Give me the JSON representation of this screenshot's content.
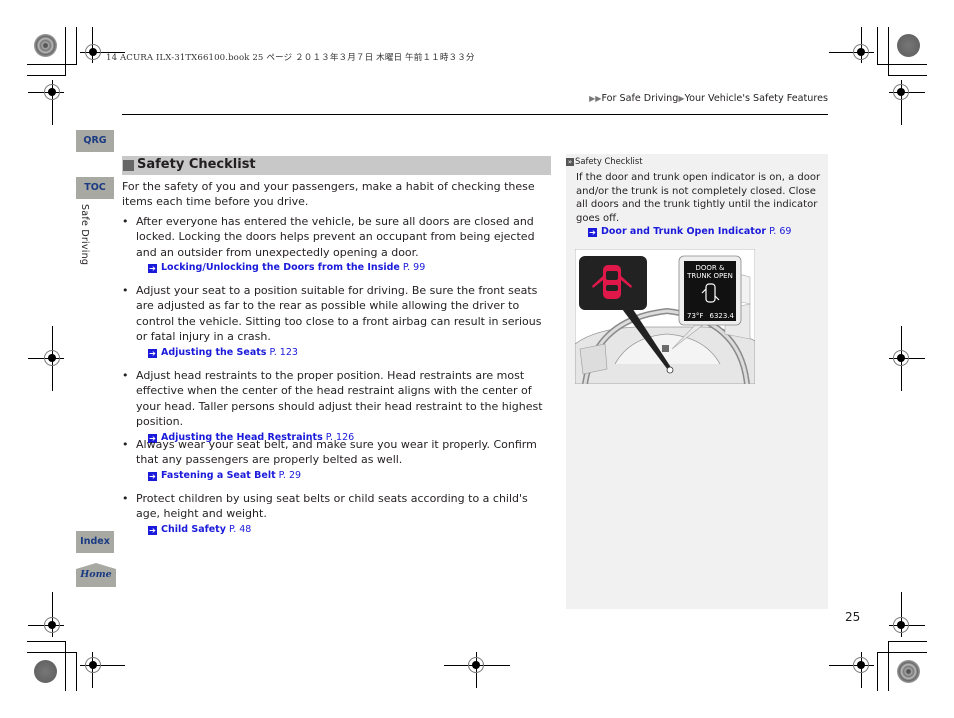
{
  "print_header": "14 ACURA ILX-31TX66100.book  25 ページ  ２０１３年３月７日  木曜日  午前１１時３３分",
  "breadcrumb": {
    "items": [
      "For Safe Driving",
      "Your Vehicle's Safety Features"
    ]
  },
  "side_nav": {
    "qrg_label": "QRG",
    "toc_label": "TOC",
    "chapter_label": "Safe Driving",
    "index_label": "Index",
    "home_label": "Home"
  },
  "section": {
    "title": "Safety Checklist",
    "intro": "For the safety of you and your passengers, make a habit of checking these items each time before you drive.",
    "bullets": [
      {
        "text": "After everyone has entered the vehicle, be sure all doors are closed and locked. Locking the doors helps prevent an occupant from being ejected and an outsider from unexpectedly opening a door.",
        "xref_title": "Locking/Unlocking the Doors from the Inside",
        "xref_page": "P. 99"
      },
      {
        "text": "Adjust your seat to a position suitable for driving. Be sure the front seats are adjusted as far to the rear as possible while allowing the driver to control the vehicle. Sitting too close to a front airbag can result in serious or fatal injury in a crash.",
        "xref_title": "Adjusting the Seats",
        "xref_page": "P. 123"
      },
      {
        "text": "Adjust head restraints to the proper position. Head restraints are most effective when the center of the head restraint aligns with the center of your head. Taller persons should adjust their head restraint to the highest position.",
        "xref_title": "Adjusting the Head Restraints",
        "xref_page": "P. 126"
      },
      {
        "text": "Always wear your seat belt, and make sure you wear it properly. Confirm that any passengers are properly belted as well.",
        "xref_title": "Fastening a Seat Belt",
        "xref_page": "P. 29"
      },
      {
        "text": "Protect children by using seat belts or child seats according to a child's age, height and weight.",
        "xref_title": "Child Safety",
        "xref_page": "P. 48"
      }
    ]
  },
  "note": {
    "heading": "Safety Checklist",
    "text": "If the door and trunk open indicator is on, a door and/or the trunk is not completely closed. Close all doors and the trunk tightly until the indicator goes off.",
    "xref_title": "Door and Trunk Open Indicator",
    "xref_page": "P. 69"
  },
  "illustration": {
    "display_line1": "DOOR &",
    "display_line2": "TRUNK OPEN",
    "display_left_value": "73°F",
    "display_right_value": "6323.4",
    "indicator_color": "#e0184a"
  },
  "page_number": "25",
  "colors": {
    "link": "#1a1adb",
    "nav_tab_bg": "#a9a9a3",
    "nav_tab_text": "#1a3b82",
    "section_head_bg": "#c8c8c8",
    "note_bg": "#f1f1f1"
  }
}
